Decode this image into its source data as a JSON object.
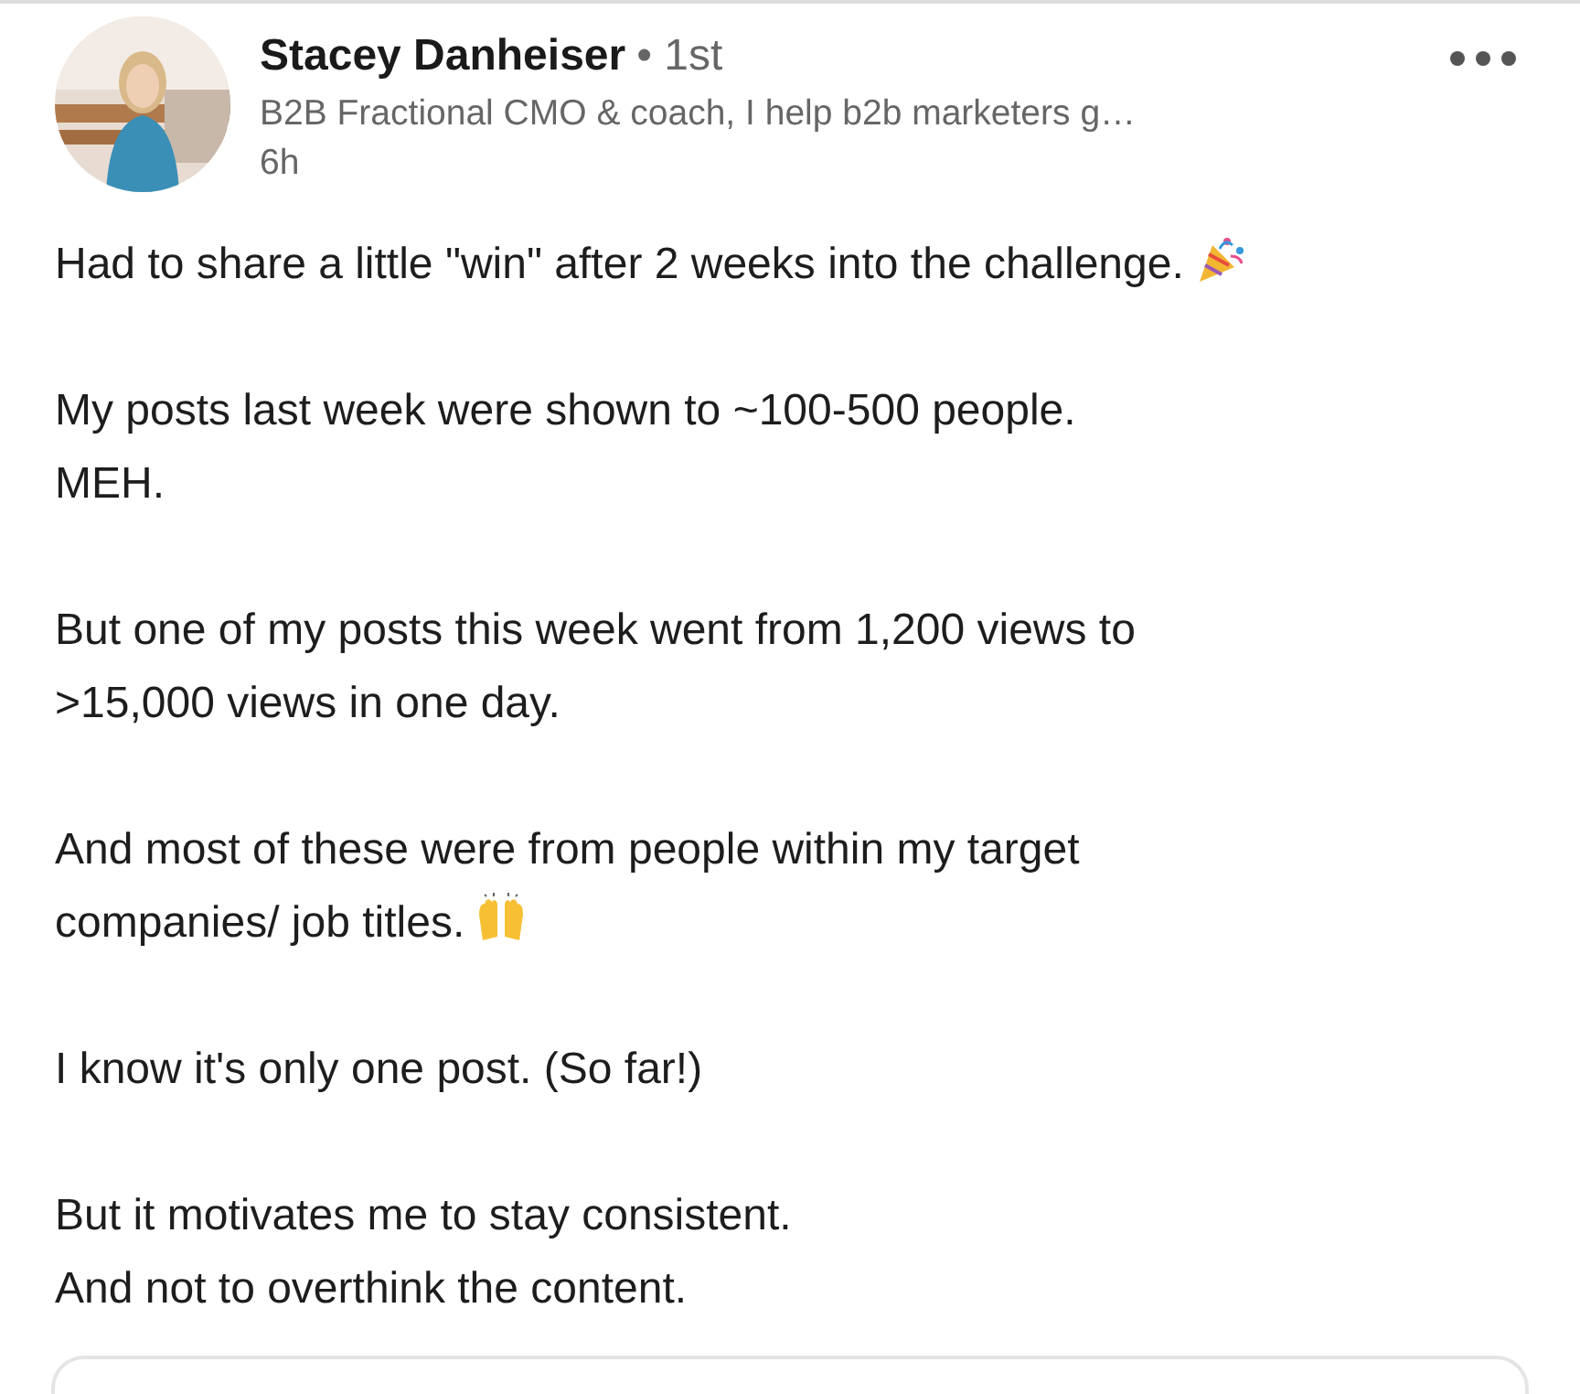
{
  "post": {
    "author": {
      "name": "Stacey Danheiser",
      "degree": "• 1st",
      "headline": "B2B Fractional CMO & coach, I help b2b marketers g…",
      "time": "6h"
    },
    "paragraphs": [
      {
        "kind": "party",
        "lines": [
          "Had to share a little \"win\" after 2 weeks into the challenge."
        ]
      },
      {
        "kind": "plain",
        "lines": [
          "My posts last week were shown to ~100-500 people.",
          "MEH."
        ]
      },
      {
        "kind": "plain",
        "lines": [
          "But one of my posts this week went from 1,200 views to",
          ">15,000 views in one day."
        ]
      },
      {
        "kind": "hands",
        "lines": [
          "And most of these were from people within my target",
          "companies/ job titles."
        ]
      },
      {
        "kind": "plain",
        "lines": [
          "I know it's only one post. (So far!)"
        ]
      },
      {
        "kind": "plain",
        "lines": [
          "But it motivates me to stay consistent.",
          "And not to overthink the content."
        ]
      }
    ]
  }
}
